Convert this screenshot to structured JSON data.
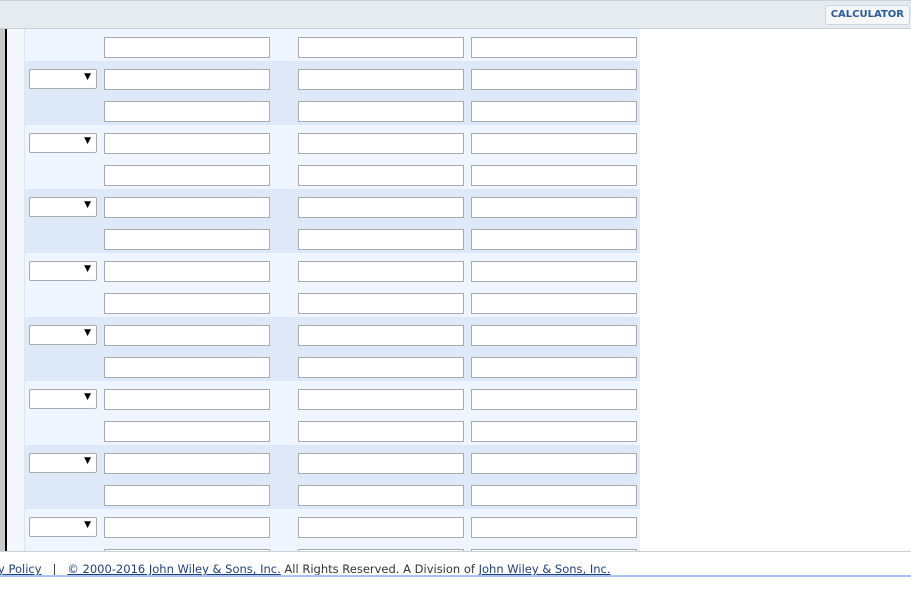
{
  "toolbar": {
    "calculator_label": "CALCULATOR"
  },
  "grid": {
    "rows": [
      {
        "band": "light",
        "select": false
      },
      {
        "band": "dark",
        "select": true
      },
      {
        "band": "dark",
        "select": false
      },
      {
        "band": "light",
        "select": true
      },
      {
        "band": "light",
        "select": false
      },
      {
        "band": "dark",
        "select": true
      },
      {
        "band": "dark",
        "select": false
      },
      {
        "band": "light",
        "select": true
      },
      {
        "band": "light",
        "select": false
      },
      {
        "band": "dark",
        "select": true
      },
      {
        "band": "dark",
        "select": false
      },
      {
        "band": "light",
        "select": true
      },
      {
        "band": "light",
        "select": false
      },
      {
        "band": "dark",
        "select": true
      },
      {
        "band": "dark",
        "select": false
      },
      {
        "band": "light",
        "select": true
      },
      {
        "band": "light",
        "select": false
      }
    ],
    "select_arrow": "▼"
  },
  "footer": {
    "privacy_link": "y Policy",
    "separator": "|",
    "copyright_link": "© 2000-2016 John Wiley & Sons, Inc.",
    "rights_text": " All Rights Reserved. A Division of ",
    "wiley_link": "John Wiley & Sons, Inc."
  },
  "colors": {
    "band_light": "#eef5ff",
    "band_dark": "#dde9f8",
    "link": "#1f3f7a",
    "accent": "#2a5a9a"
  }
}
